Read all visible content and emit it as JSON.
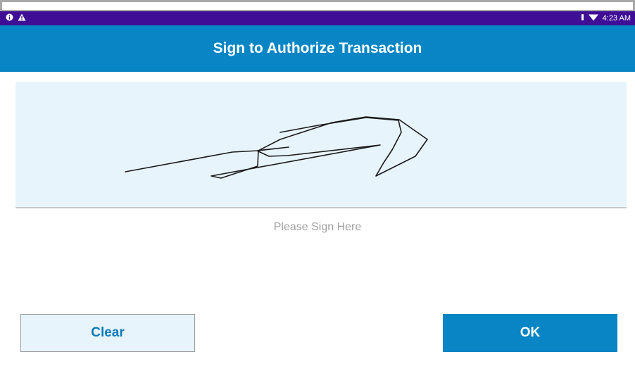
{
  "status_bar": {
    "left_icons": [
      "info-icon",
      "warning-icon"
    ],
    "right_icons": [
      "vibrate-icon",
      "wifi-icon"
    ],
    "time": "4:23 AM"
  },
  "app_bar": {
    "title": "Sign to Authorize Transaction"
  },
  "signature_pad": {
    "hint": "Please Sign Here"
  },
  "actions": {
    "clear_label": "Clear",
    "ok_label": "OK"
  },
  "colors": {
    "status_bar": "#3f0e96",
    "app_bar": "#0785c4",
    "pad_background": "#e8f4fc",
    "clear_text": "#0a7ab8"
  }
}
